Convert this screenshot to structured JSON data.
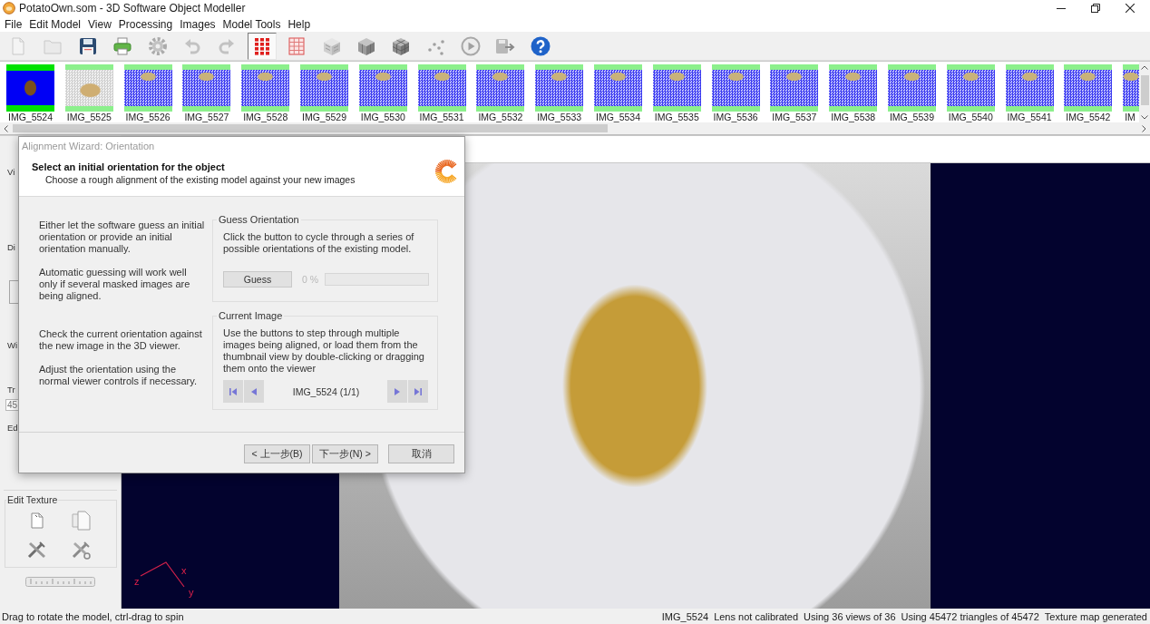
{
  "window": {
    "title": "PotatoOwn.som - 3D Software Object Modeller"
  },
  "menu": [
    "File",
    "Edit Model",
    "View",
    "Processing",
    "Images",
    "Model Tools",
    "Help"
  ],
  "toolbar": [
    {
      "disabled": true,
      "pressed": false
    },
    {
      "disabled": true,
      "pressed": false
    },
    {
      "disabled": false,
      "pressed": false
    },
    {
      "disabled": false,
      "pressed": false
    },
    {
      "disabled": false,
      "pressed": false
    },
    {
      "disabled": true,
      "pressed": false
    },
    {
      "disabled": true,
      "pressed": false
    },
    {
      "disabled": false,
      "pressed": true
    },
    {
      "disabled": false,
      "pressed": false
    },
    {
      "disabled": false,
      "pressed": false
    },
    {
      "disabled": false,
      "pressed": false
    },
    {
      "disabled": false,
      "pressed": false
    },
    {
      "disabled": false,
      "pressed": false
    },
    {
      "disabled": false,
      "pressed": false
    },
    {
      "disabled": false,
      "pressed": false
    },
    {
      "disabled": false,
      "pressed": false
    }
  ],
  "thumbnails": [
    {
      "label": "IMG_5524",
      "kind": "solid"
    },
    {
      "label": "IMG_5525",
      "kind": "grey"
    },
    {
      "label": "IMG_5526",
      "kind": "checker"
    },
    {
      "label": "IMG_5527",
      "kind": "checker"
    },
    {
      "label": "IMG_5528",
      "kind": "checker"
    },
    {
      "label": "IMG_5529",
      "kind": "checker"
    },
    {
      "label": "IMG_5530",
      "kind": "checker"
    },
    {
      "label": "IMG_5531",
      "kind": "checker"
    },
    {
      "label": "IMG_5532",
      "kind": "checker"
    },
    {
      "label": "IMG_5533",
      "kind": "checker"
    },
    {
      "label": "IMG_5534",
      "kind": "checker"
    },
    {
      "label": "IMG_5535",
      "kind": "checker"
    },
    {
      "label": "IMG_5536",
      "kind": "checker"
    },
    {
      "label": "IMG_5537",
      "kind": "checker"
    },
    {
      "label": "IMG_5538",
      "kind": "checker"
    },
    {
      "label": "IMG_5539",
      "kind": "checker"
    },
    {
      "label": "IMG_5540",
      "kind": "checker"
    },
    {
      "label": "IMG_5541",
      "kind": "checker"
    },
    {
      "label": "IMG_5542",
      "kind": "checker"
    },
    {
      "label": "IM",
      "kind": "checker"
    }
  ],
  "sidebar": {
    "sections": [
      {
        "title": "Vi",
        "kind": "plain"
      },
      {
        "title": "Di",
        "kind": "box"
      },
      {
        "title": "Wi",
        "kind": "plain"
      },
      {
        "title": "Tr",
        "kind": "field",
        "value": "45"
      },
      {
        "title": "Ed",
        "kind": "plain"
      }
    ],
    "edit_texture": {
      "title": "Edit Texture"
    }
  },
  "viewer": {
    "axes": [
      "z",
      "x",
      "y"
    ]
  },
  "dialog": {
    "title": "Alignment Wizard: Orientation",
    "heading": "Select an initial orientation for the object",
    "subheading": "Choose a rough alignment of the existing model against your new images",
    "instructions": [
      {
        "paragraphs": [
          "Either let the software guess an initial orientation or provide an initial orientation manually.",
          "Automatic guessing will work well only if several masked images are being aligned."
        ]
      },
      {
        "paragraphs": [
          "Check the current orientation against the new image in the 3D viewer.",
          "Adjust the orientation using the normal viewer controls if necessary."
        ]
      }
    ],
    "guess_orientation": {
      "title": "Guess Orientation",
      "text": "Click the button to cycle through a series of possible orientations of the existing model.",
      "button": "Guess",
      "reading": "0 %",
      "level": 0
    },
    "current_image": {
      "title": "Current Image",
      "text": "Use the buttons to step through multiple images being aligned, or load them from the thumbnail view by double-clicking or dragging them onto the viewer",
      "image_label": "IMG_5524 (1/1)"
    },
    "buttons": [
      "< 上一步(B)",
      "下一步(N) >",
      "取消"
    ]
  },
  "status_bar": {
    "message": "Drag to rotate the model, ctrl-drag to spin",
    "panels": [
      "IMG_5524",
      "Lens not calibrated",
      "Using 36 views of 36",
      "Using 45472 triangles of 45472",
      "Texture map generated"
    ]
  }
}
